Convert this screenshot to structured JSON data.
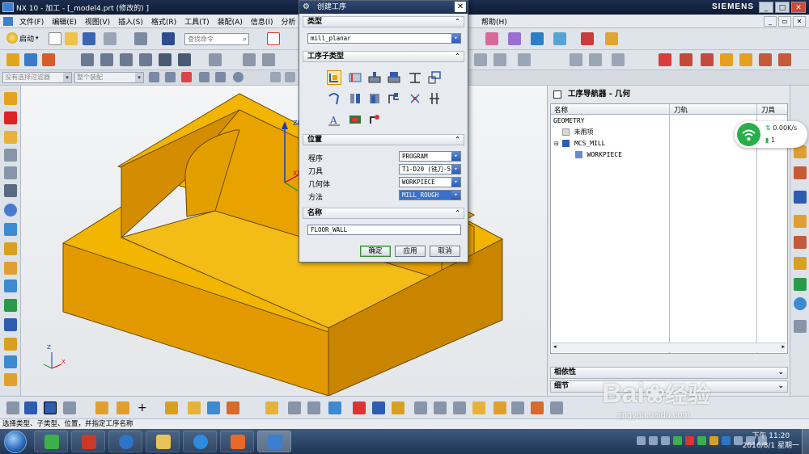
{
  "window": {
    "title": "NX 10 - 加工 - [_model4.prt  (修改的) ]",
    "brand": "SIEMENS",
    "controls": [
      "_",
      "□",
      "✕"
    ]
  },
  "menu": {
    "items": [
      "文件(F)",
      "编辑(E)",
      "视图(V)",
      "插入(S)",
      "格式(R)",
      "工具(T)",
      "装配(A)",
      "信息(I)",
      "分析"
    ],
    "right_item": "帮助(H)"
  },
  "toolbar": {
    "start_label": "启动",
    "search_placeholder": "查找命令",
    "filter_combo": "没有选择过滤器",
    "assembly_combo": "整个装配"
  },
  "dialog": {
    "title": "创建工序",
    "type_section": "类型",
    "type_value": "mill_planar",
    "subtype_section": "工序子类型",
    "location_section": "位置",
    "program_label": "程序",
    "program_value": "PROGRAM",
    "tool_label": "刀具",
    "tool_value": "T1-D20 (铣刀-5",
    "geometry_label": "几何体",
    "geometry_value": "WORKPIECE",
    "method_label": "方法",
    "method_value": "MILL_ROUGH",
    "name_section": "名称",
    "name_value": "FLOOR_WALL",
    "ok_button": "确定",
    "apply_button": "应用",
    "cancel_button": "取消"
  },
  "navigator": {
    "title": "工序导航器 - 几何",
    "columns": [
      "名称",
      "刀轨",
      "刀具"
    ],
    "rows": [
      {
        "label": "GEOMETRY",
        "indent": 0
      },
      {
        "label": "未用项",
        "indent": 1
      },
      {
        "label": "MCS_MILL",
        "indent": 1
      },
      {
        "label": "WORKPIECE",
        "indent": 2
      }
    ],
    "dependency_section": "相依性",
    "details_section": "细节"
  },
  "viewport": {
    "axis_zm": "ZM",
    "axis_xm": "XM",
    "axis_z": "Z",
    "axis_x": "X"
  },
  "status": {
    "message": "选择类型、子类型、位置，并指定工序名称"
  },
  "network": {
    "speed": "0.00K/s",
    "connections": "1"
  },
  "watermark": {
    "brand": "Bai",
    "brand2": "经验",
    "url": "jingyan.baidu.com"
  },
  "clock": {
    "time": "下午 11:20",
    "date": "2016/8/1 星期一"
  },
  "colors": {
    "part_top": "#f2b500",
    "part_side_light": "#e69c00",
    "part_side_dark": "#c98500",
    "accent_blue": "#2e5cb0",
    "ok_green": "#3c8b3c"
  }
}
